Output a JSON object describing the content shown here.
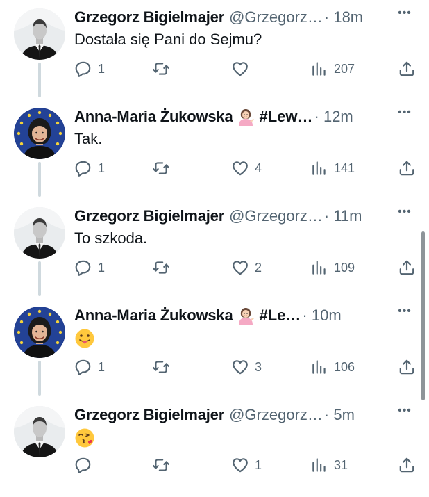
{
  "tweets": [
    {
      "author": "Grzegorz Bigielmajer",
      "handle": "@Grzegorz…",
      "time": "· 18m",
      "text": "Dostała się Pani do Sejmu?",
      "replies": "1",
      "retweets": "",
      "likes": "",
      "views": "207",
      "avatar": "man-in-suit-avatar"
    },
    {
      "author": "Anna-Maria Żukowska",
      "badge_emoji": "woman-tipping-hand",
      "tag": "#Lew…",
      "time": "· 12m",
      "text": "Tak.",
      "replies": "1",
      "retweets": "",
      "likes": "4",
      "views": "141",
      "avatar": "woman-eu-flag-avatar"
    },
    {
      "author": "Grzegorz Bigielmajer",
      "handle": "@Grzegorz…",
      "time": "· 11m",
      "text": "To szkoda.",
      "replies": "1",
      "retweets": "",
      "likes": "2",
      "views": "109",
      "avatar": "man-in-suit-avatar"
    },
    {
      "author": "Anna-Maria Żukowska",
      "badge_emoji": "woman-tipping-hand",
      "tag": "#Le…",
      "time": "· 10m",
      "text_emoji": "face-with-tongue",
      "replies": "1",
      "retweets": "",
      "likes": "3",
      "views": "106",
      "avatar": "woman-eu-flag-avatar"
    },
    {
      "author": "Grzegorz Bigielmajer",
      "handle": "@Grzegorz…",
      "time": "· 5m",
      "text_emoji": "face-blowing-kiss",
      "replies": "",
      "retweets": "",
      "likes": "1",
      "views": "31",
      "avatar": "man-in-suit-avatar"
    }
  ],
  "more_label": "•••",
  "colors": {
    "text_primary": "#0f1419",
    "text_secondary": "#536471",
    "thread_line": "#cfd9de",
    "scrollbar": "#8e9499"
  }
}
